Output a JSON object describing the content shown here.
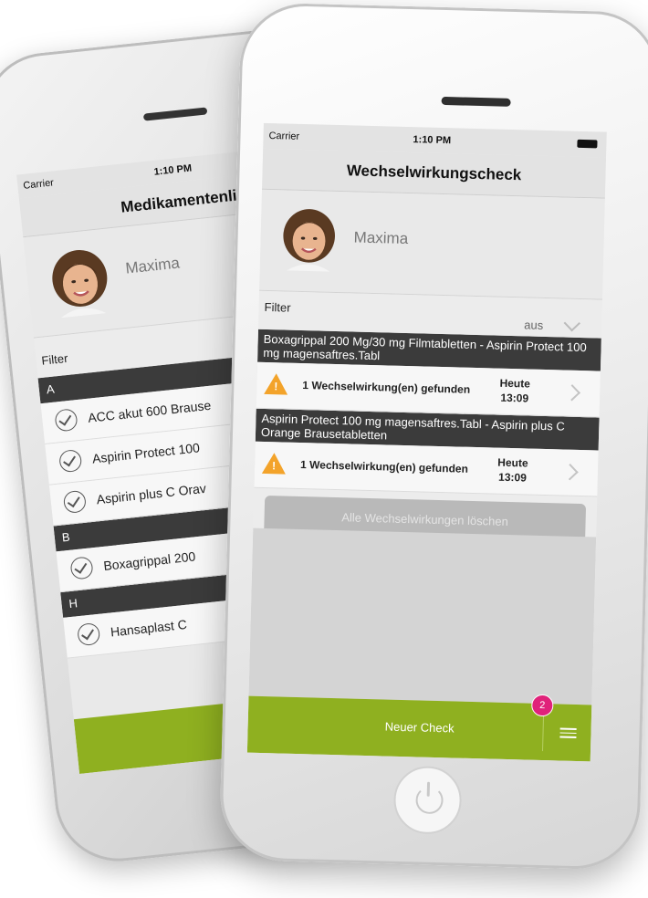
{
  "back_phone": {
    "status": {
      "carrier": "Carrier",
      "time": "1:10 PM"
    },
    "nav_title": "Medikamentenlis",
    "profile_name": "Maxima",
    "filter_label": "Filter",
    "sections": [
      {
        "letter": "A",
        "items": [
          "ACC akut 600 Brause",
          "Aspirin Protect 100",
          "Aspirin plus C Orav"
        ]
      },
      {
        "letter": "B",
        "items": [
          "Boxagrippal 200"
        ]
      },
      {
        "letter": "H",
        "items": [
          "Hansaplast C"
        ]
      }
    ],
    "footer_plus": "+"
  },
  "front_phone": {
    "status": {
      "carrier": "Carrier",
      "time": "1:10 PM"
    },
    "nav_title": "Wechselwirkungscheck",
    "profile_name": "Maxima",
    "filter": {
      "label": "Filter",
      "value": "aus"
    },
    "interactions": [
      {
        "pair": "Boxagrippal 200 Mg/30 mg Filmtabletten - Aspirin Protect 100 mg magensaftres.Tabl",
        "text": "1 Wechselwirkung(en) gefunden",
        "date": "Heute",
        "time": "13:09"
      },
      {
        "pair": "Aspirin Protect 100 mg magensaftres.Tabl - Aspirin plus C Orange Brausetabletten",
        "text": "1 Wechselwirkung(en) gefunden",
        "date": "Heute",
        "time": "13:09"
      }
    ],
    "delete_all_label": "Alle Wechselwirkungen löschen",
    "footer": {
      "new_check_label": "Neuer Check",
      "badge_count": "2"
    }
  },
  "icons": {
    "warning": "warning-icon",
    "check": "check-circle-icon",
    "menu": "list-menu-icon",
    "power": "power-icon"
  },
  "colors": {
    "accent_green": "#8fb020",
    "section_dark": "#3b3b3b",
    "warning_orange": "#f3a32a",
    "badge_pink": "#e0227a"
  }
}
